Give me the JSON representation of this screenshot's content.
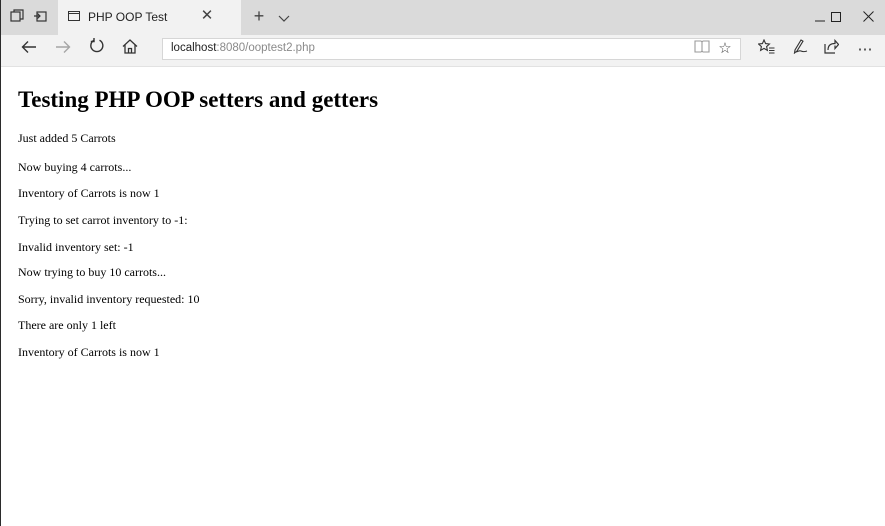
{
  "browser": {
    "tab": {
      "title": "PHP OOP Test"
    },
    "address": {
      "host": "localhost",
      "rest": ":8080/ooptest2.php"
    }
  },
  "page": {
    "heading": "Testing PHP OOP setters and getters",
    "lines": [
      "Just added 5 Carrots",
      "Now buying 4 carrots...",
      "Inventory of Carrots is now 1",
      "Trying to set carrot inventory to -1:",
      "Invalid inventory set: -1",
      "Now trying to buy 10 carrots...",
      "Sorry, invalid inventory requested: 10",
      "There are only 1 left",
      "Inventory of Carrots is now 1"
    ]
  }
}
